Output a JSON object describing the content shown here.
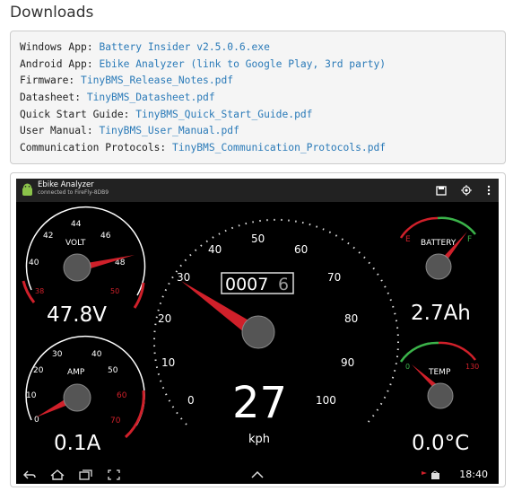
{
  "page": {
    "heading": "Downloads"
  },
  "downloads": [
    {
      "label": "Windows App:",
      "link": "Battery Insider v2.5.0.6.exe"
    },
    {
      "label": "Android App:",
      "link": "Ebike Analyzer (link to Google Play, 3rd party)"
    },
    {
      "label": "Firmware:",
      "link": "TinyBMS_Release_Notes.pdf"
    },
    {
      "label": "Datasheet:",
      "link": "TinyBMS_Datasheet.pdf"
    },
    {
      "label": "Quick Start Guide:",
      "link": "TinyBMS_Quick_Start_Guide.pdf"
    },
    {
      "label": "User Manual:",
      "link": "TinyBMS_User_Manual.pdf"
    },
    {
      "label": "Communication Protocols:",
      "link": "TinyBMS_Communication_Protocols.pdf"
    }
  ],
  "app": {
    "title": "Ebike Analyzer",
    "subtitle": "connected to FireFly-8DB9",
    "icons": [
      "save-icon",
      "location-icon",
      "overflow-menu-icon"
    ],
    "clock": "18:40"
  },
  "gauges": {
    "volt": {
      "label": "VOLT",
      "ticks": [
        "38",
        "40",
        "42",
        "44",
        "46",
        "48",
        "50"
      ],
      "readout": "47.8V"
    },
    "amp": {
      "label": "AMP",
      "ticks": [
        "0",
        "10",
        "20",
        "30",
        "40",
        "50",
        "60",
        "70"
      ],
      "readout": "0.1A"
    },
    "speed": {
      "ticks": [
        "0",
        "10",
        "20",
        "30",
        "40",
        "50",
        "60",
        "70",
        "80",
        "90",
        "100"
      ],
      "odometer": "0007",
      "odometer_decimal": "6",
      "value": "27",
      "unit": "kph"
    },
    "battery": {
      "label": "BATTERY",
      "empty": "E",
      "full": "F",
      "readout": "2.7Ah"
    },
    "temp": {
      "label": "TEMP",
      "min": "0",
      "max": "130",
      "readout": "0.0°C"
    }
  },
  "colors": {
    "link": "#2a7ab8",
    "redline": "#d0202a",
    "green": "#3bb34a"
  }
}
